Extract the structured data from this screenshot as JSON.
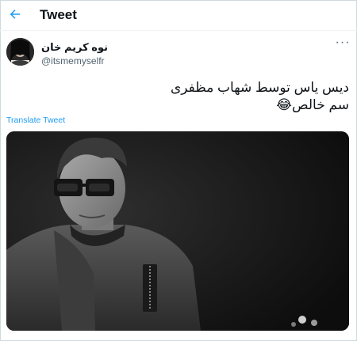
{
  "header": {
    "title": "Tweet",
    "back_icon": "arrow-left-icon"
  },
  "colors": {
    "accent": "#1d9bf0",
    "text": "#0f1419",
    "secondary": "#536471"
  },
  "tweet": {
    "author_name": "نوه کریم خان",
    "author_handle": "@itsmemyselfr",
    "more_icon": "more-dots-icon",
    "text_line1": "دیس یاس توسط شهاب مظفری",
    "text_line2": "سم خالص😂",
    "translate_label": "Translate Tweet"
  }
}
